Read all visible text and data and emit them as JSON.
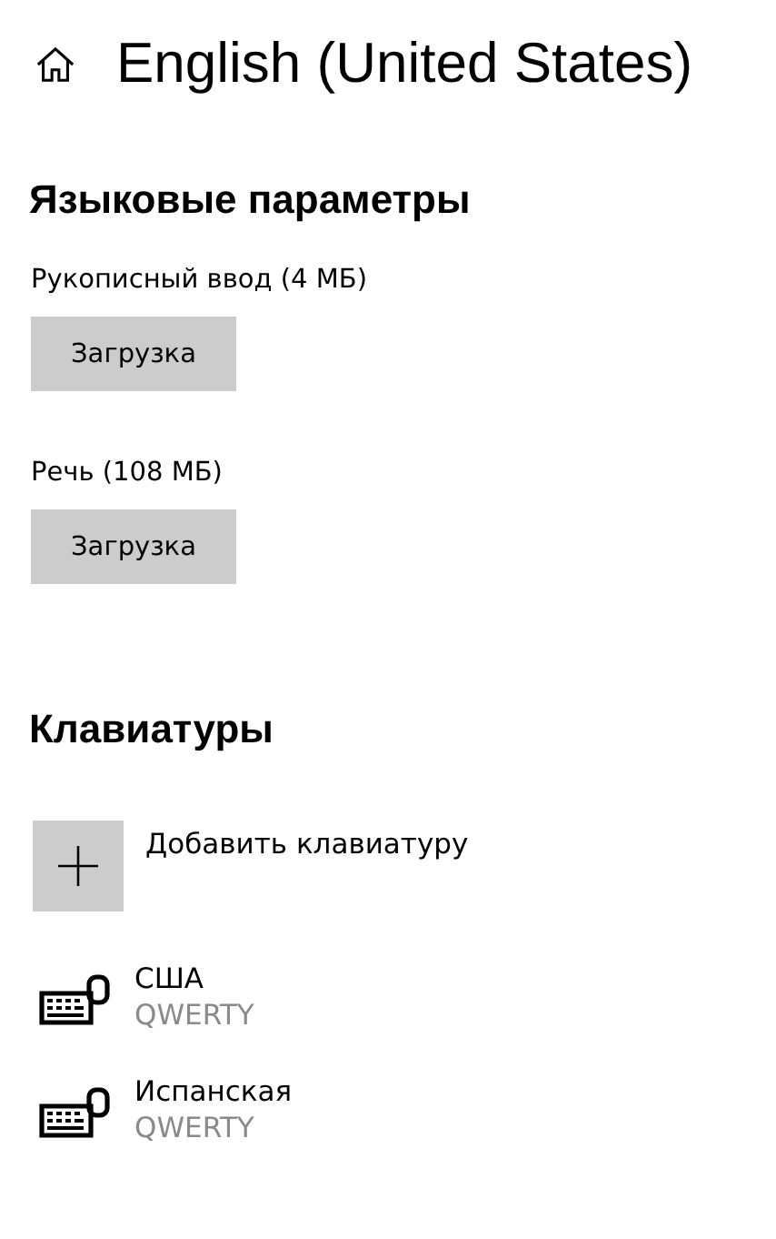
{
  "header": {
    "title": "English (United States)"
  },
  "language_options": {
    "heading": "Языковые параметры",
    "items": [
      {
        "label": "Рукописный ввод (4 МБ)",
        "button": "Загрузка"
      },
      {
        "label": "Речь (108 МБ)",
        "button": "Загрузка"
      }
    ]
  },
  "keyboards": {
    "heading": "Клавиатуры",
    "add_label": "Добавить клавиатуру",
    "items": [
      {
        "name": "США",
        "layout": "QWERTY"
      },
      {
        "name": "Испанская",
        "layout": "QWERTY"
      }
    ]
  }
}
